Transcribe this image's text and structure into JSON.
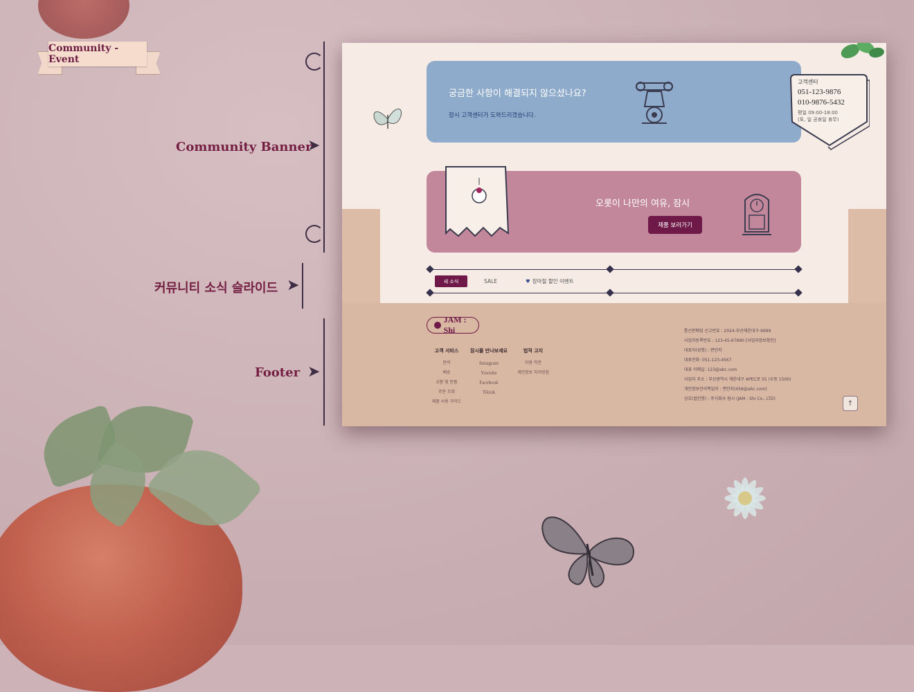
{
  "page": {
    "title": "Community - Event",
    "labels": {
      "community_banner": "Community Banner",
      "news_slide": "커뮤니티 소식 슬라이드",
      "footer": "Footer"
    }
  },
  "banner_cs": {
    "title": "궁금한 사항이 해결되지 않으셨나요?",
    "subtitle": "잠시 고객센터가 도와드리겠습니다.",
    "card_label": "고객센터",
    "phone1": "051-123-9876",
    "phone2": "010-9876-5432",
    "hours1": "평일 09:00-18:00",
    "hours2": "(토, 일 공휴일 휴무)"
  },
  "banner_product": {
    "title": "오롯이 나만의 여유, 잠시",
    "button": "제품 보러가기"
  },
  "tabs": {
    "active": "새 소식",
    "sale": "SALE",
    "event": "장마철 할인 이벤트"
  },
  "footer": {
    "logo": "JAM : Shi",
    "columns": [
      {
        "heading": "고객 서비스",
        "items": [
          "문의",
          "배송",
          "교환 및 반품",
          "주문 조회",
          "제품 사용 가이드"
        ]
      },
      {
        "heading": "잠시를 만나보세요",
        "items": [
          "Instagram",
          "Youtube",
          "Facebook",
          "Tiktok"
        ]
      },
      {
        "heading": "법적 고지",
        "items": [
          "이용 약관",
          "개인정보 처리방침"
        ]
      }
    ],
    "info": [
      "통신판매업 신고번호 : 2024-부산해운대구-9999",
      "사업자등록번호 : 123-45-67890 [사업자정보확인]",
      "대표자(성명) : 변민지",
      "대표전화: 051-123-4567",
      "대표 이메일: 123@abc.com",
      "사업자 주소 : 부산광역시 해운대구 APEC로 55 (우동 1500)",
      "개인정보관리책임자 : 변민지(456@abc.com)",
      "상호(법인명) : 주식회사 잠시 (JAM : Shi Co., LTD)"
    ],
    "top_button": "↑"
  },
  "colors": {
    "accent": "#6e1947",
    "blue_banner": "#8fabcb",
    "pink_banner": "#c2879a",
    "footer_bg": "#d8b7a3"
  }
}
